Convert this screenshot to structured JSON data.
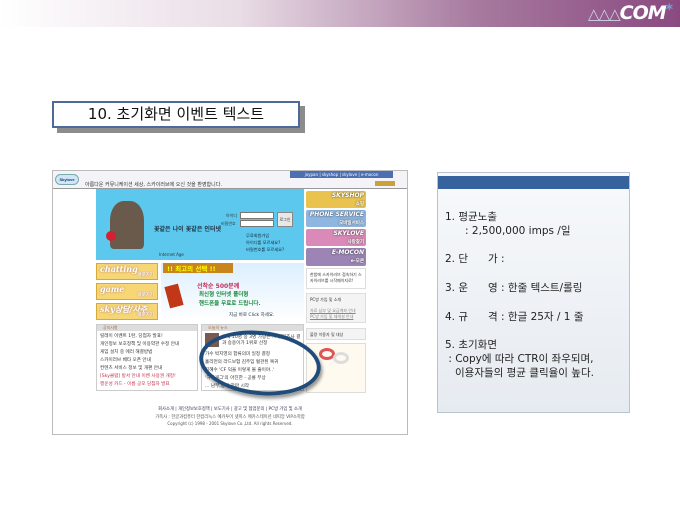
{
  "header": {
    "logo": "△△△COM*"
  },
  "slide_title": "10. 초기화면 이벤트 텍스트",
  "screenshot": {
    "site_greeting": "아름다운 커뮤니케이션 세상, 스카이러브에 오신 것을 환영합니다.",
    "top_nav": "joypan | skyshop | skylove | e-mocon",
    "hero_slogan": "꽃같은 나이  꽃같은 인터넷",
    "internet_age": "Internet Age",
    "id_label": "아이디",
    "pw_label": "비밀번호",
    "login_button": "로그인",
    "links": [
      "무료회원가입",
      "아이디를 모르세요?",
      "비밀번호를 모르세요?"
    ],
    "right_buttons": [
      "SKYSHOP",
      "PHONE SERVICE",
      "SKYLOVE",
      "E-MOCON"
    ],
    "right_sub": [
      "쇼핑",
      "모바일서비스",
      "사랑찾기",
      "e-모콘"
    ],
    "right_text": "한밤에 스카이러브 접속하기 스카이러브를 시작페이지로!",
    "pc_room": "PC방 가입 및 소개",
    "pc_links": "자료 남부 및 요금계좌 안내 PC방 가입 및 재개설 안내",
    "bad_user": "불량 이용자 및 대상",
    "left_menus": [
      "chatting",
      "game",
      "sky상담/사주"
    ],
    "left_menu_sub": "바로가기",
    "banner_title": "!! 최고의 선택 !!",
    "banner_lines": [
      "선착순 500분께",
      "최신형 인터넷 폴더형",
      "핸드폰을 무료로 드립니다."
    ],
    "banner_click": "지금 바로 Click 하세요.",
    "notice_title": "공지사항",
    "notice_items": [
      "릴레이 이벤트 1탄, 당첨자 발표!",
      "개인정보 보호정책 및 이용약관 수정 안내",
      "게임 설치 중 에러 해결방법",
      "스카이러브 베타 오픈 안내",
      "컨텐츠 서비스 정보 및 개편 안내",
      "[Sky클럽] 방서 안내 이벤 사용권 개정!",
      "행운성 카드 - 이름 공모 당첨자 발표"
    ],
    "news_title": "오늘의 뉴스",
    "news_items": [
      "고객 10명 중 3명 가량은 ... 설문조사 결과 승용이가 1위로 선정",
      "가수 박지영의 합류의미 일정 결정",
      "홀리먼의 라드보험 김주임 혈관된 복귀",
      "김혜수 'CF 덕을 이렇게 볼 줄이야..'",
      "'허무개그'의 아진한 - 공룡 부상",
      "... 남부,중부 장마 시작"
    ],
    "footer_links": "회사소개 | 개인정보보호정책 | 보도기사 | 광고 및 협업문의 | PC방 가입 및 소개",
    "footer_family": "가족사 : 한글과컴퓨터 한컴리눅스 예카투어 넷피스 예카스테이션 네띠앙 VIP소학합",
    "copyright": "Copyright (c) 1998 - 2001 Skylove Co.,Ltd. All rights Reserved."
  },
  "panel": {
    "items": [
      "1. 평균노출",
      "      : 2,500,000 imps /일",
      "2. 단      가 :",
      "3. 운      영 : 한줄 텍스트/롤링",
      "4. 규      격 : 한글 25자 / 1 줄",
      "5. 초기화면",
      " : Copy에 따라 CTR이 좌우되며,",
      "   이용자들의 평균 클릭율이 높다."
    ]
  },
  "colors": {
    "panel_header": "#36639d",
    "title_border": "#4d6a9a",
    "highlight_oval": "#1f4c7a",
    "hero_bg": "#5cc8ee"
  }
}
